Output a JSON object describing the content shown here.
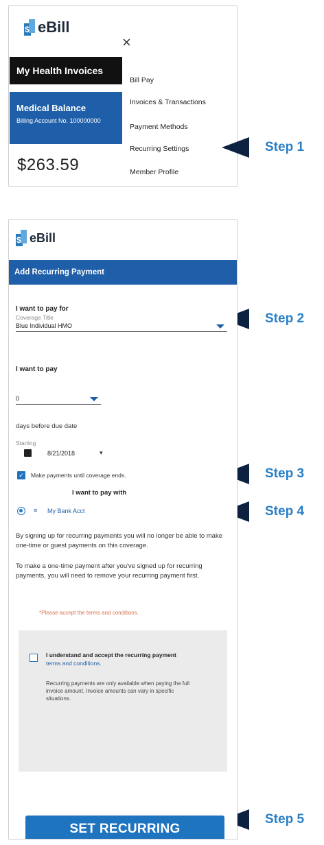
{
  "panel1": {
    "logo": "eBill",
    "logo_glyph": "$",
    "close_icon": "×",
    "title_bar": "My Health Invoices",
    "balance_title": "Medical Balance",
    "billing_account": "Billing Account No. 100000000",
    "amount": "$263.59",
    "menu": [
      "Bill Pay",
      "Invoices & Transactions",
      "Payment Methods",
      "Recurring Settings",
      "Member Profile"
    ]
  },
  "steps": [
    "Step 1",
    "Step 2",
    "Step 3",
    "Step 4",
    "Step 5"
  ],
  "panel2": {
    "logo": "eBill",
    "logo_glyph": "$",
    "header": "Add Recurring Payment",
    "pay_for_label": "I want to pay for",
    "coverage_title_placeholder": "Coverage Title",
    "coverage_value": "Blue Individual HMO",
    "pay_label": "I want to pay",
    "days_value": "0",
    "days_suffix": "days before due date",
    "starting_label": "Starting",
    "start_date": "8/21/2018",
    "make_payments_text": "Make payments until coverage ends.",
    "pay_with_label": "I want to pay with",
    "bank_account": "My Bank Acct",
    "info_text_1": "By signing up for recurring payments you will no longer be able to make one-time or guest payments on this coverage.",
    "info_text_2": "To make a one-time payment after you've signed up for recurring payments, you will need to remove your recurring payment first.",
    "warning_text": "*Please accept the terms and conditions.",
    "accept_text": "I understand and accept the recurring payment",
    "terms_link": "terms and conditions.",
    "note_text": "Recurring payments are only available when paying the full invoice amount. Invoice amounts can vary in specific situations.",
    "button": "SET RECURRING"
  },
  "colors": {
    "brand_blue": "#1f5ea8",
    "button_blue": "#1f74bf",
    "step_blue": "#2a7fc7",
    "arrow_navy": "#0d2240",
    "warning": "#d9704c"
  }
}
